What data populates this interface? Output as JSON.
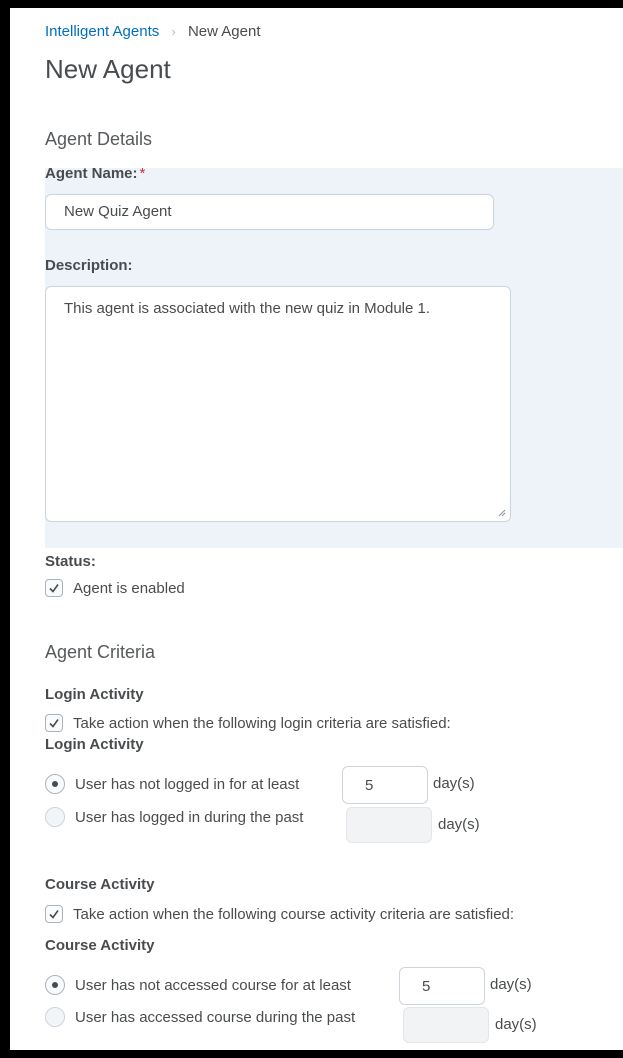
{
  "breadcrumb": {
    "parent": "Intelligent Agents",
    "separator": "›",
    "current": "New Agent"
  },
  "page_title": "New Agent",
  "agent_details": {
    "heading": "Agent Details",
    "name_label": "Agent Name:",
    "name_required_marker": "*",
    "name_value": "New Quiz Agent",
    "description_label": "Description:",
    "description_value": "This agent is associated with the new quiz in Module 1.",
    "status_label": "Status:",
    "enabled_label": "Agent is enabled",
    "enabled_checked": true
  },
  "agent_criteria": {
    "heading": "Agent Criteria",
    "login": {
      "section_label": "Login Activity",
      "checkbox_label": "Take action when the following login criteria are satisfied:",
      "checkbox_checked": true,
      "sub_label": "Login Activity",
      "option1_label": "User has not logged in for at least",
      "option1_value": "5",
      "option1_unit": "day(s)",
      "option2_label": "User has logged in during the past",
      "option2_value": "",
      "option2_unit": "day(s)",
      "selected_option": 1
    },
    "course": {
      "section_label": "Course Activity",
      "checkbox_label": "Take action when the following course activity criteria are satisfied:",
      "checkbox_checked": true,
      "sub_label": "Course Activity",
      "option1_label": "User has not accessed course for at least",
      "option1_value": "5",
      "option1_unit": "day(s)",
      "option2_label": "User has accessed course during the past",
      "option2_value": "",
      "option2_unit": "day(s)",
      "selected_option": 1
    }
  },
  "colors": {
    "link": "#006fbf",
    "text": "#494c4e",
    "shaded_panel": "#edf3f8"
  },
  "icons": {
    "check": "check-icon",
    "radio_dot": "radio-dot-icon",
    "separator": "chevron-right-icon"
  }
}
